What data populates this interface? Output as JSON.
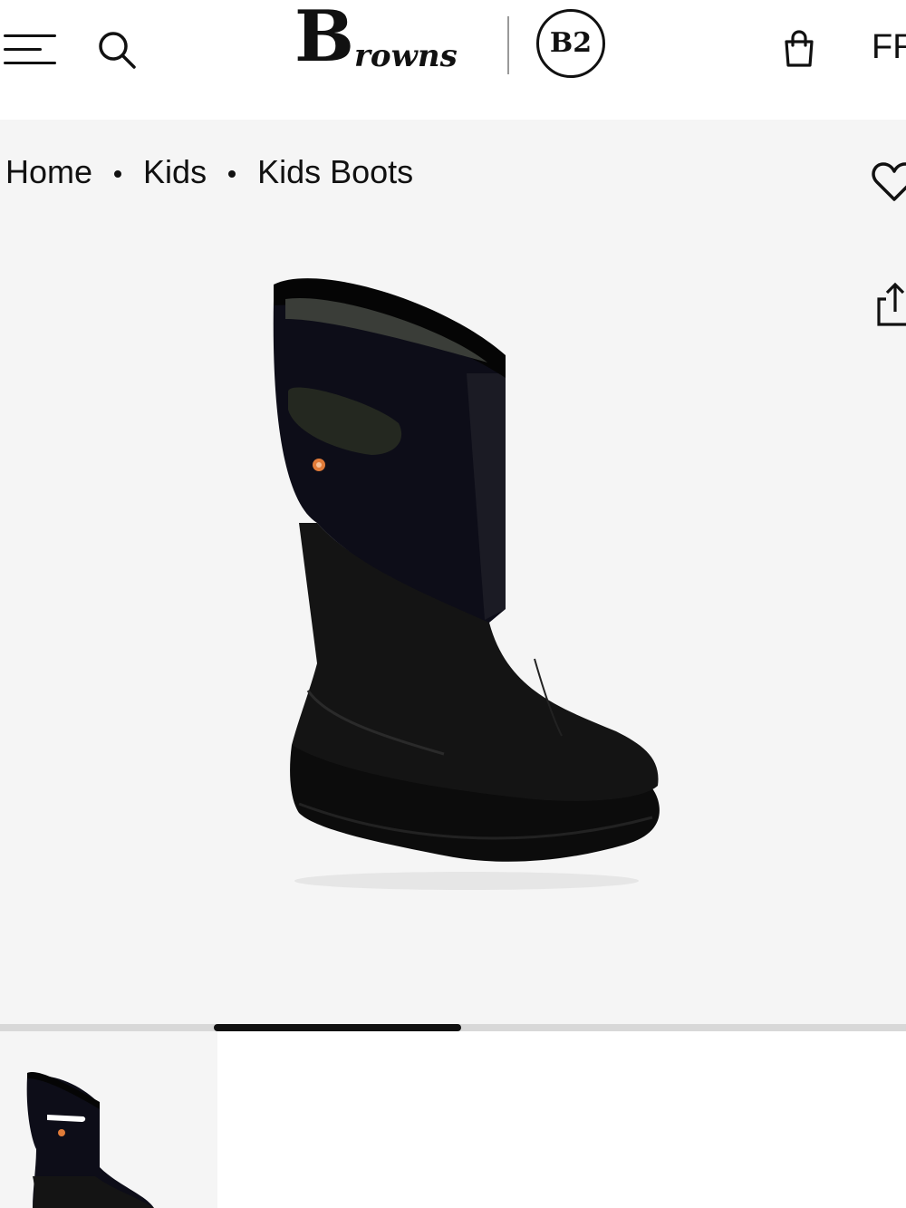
{
  "header": {
    "brand_initial": "B",
    "brand_script": "rowns",
    "b2_badge": "B2",
    "currency_partial": "FR",
    "menu_icon": "hamburger-menu-icon",
    "search_icon": "search-icon",
    "bag_icon": "shopping-bag-icon"
  },
  "breadcrumb": {
    "items": [
      "Home",
      "Kids",
      "Kids Boots"
    ]
  },
  "actions": {
    "wishlist_icon": "heart-icon",
    "share_icon": "share-icon"
  },
  "gallery": {
    "progress_fraction": 0.273,
    "main_image": "black-neoprene-rain-boot",
    "thumbnail_image": "black-rain-boot-thumbnail"
  },
  "colors": {
    "page_bg": "#ffffff",
    "hero_bg": "#f5f5f5",
    "text": "#111111",
    "track": "#d8d8d8",
    "accent_logo": "#e07b39"
  }
}
